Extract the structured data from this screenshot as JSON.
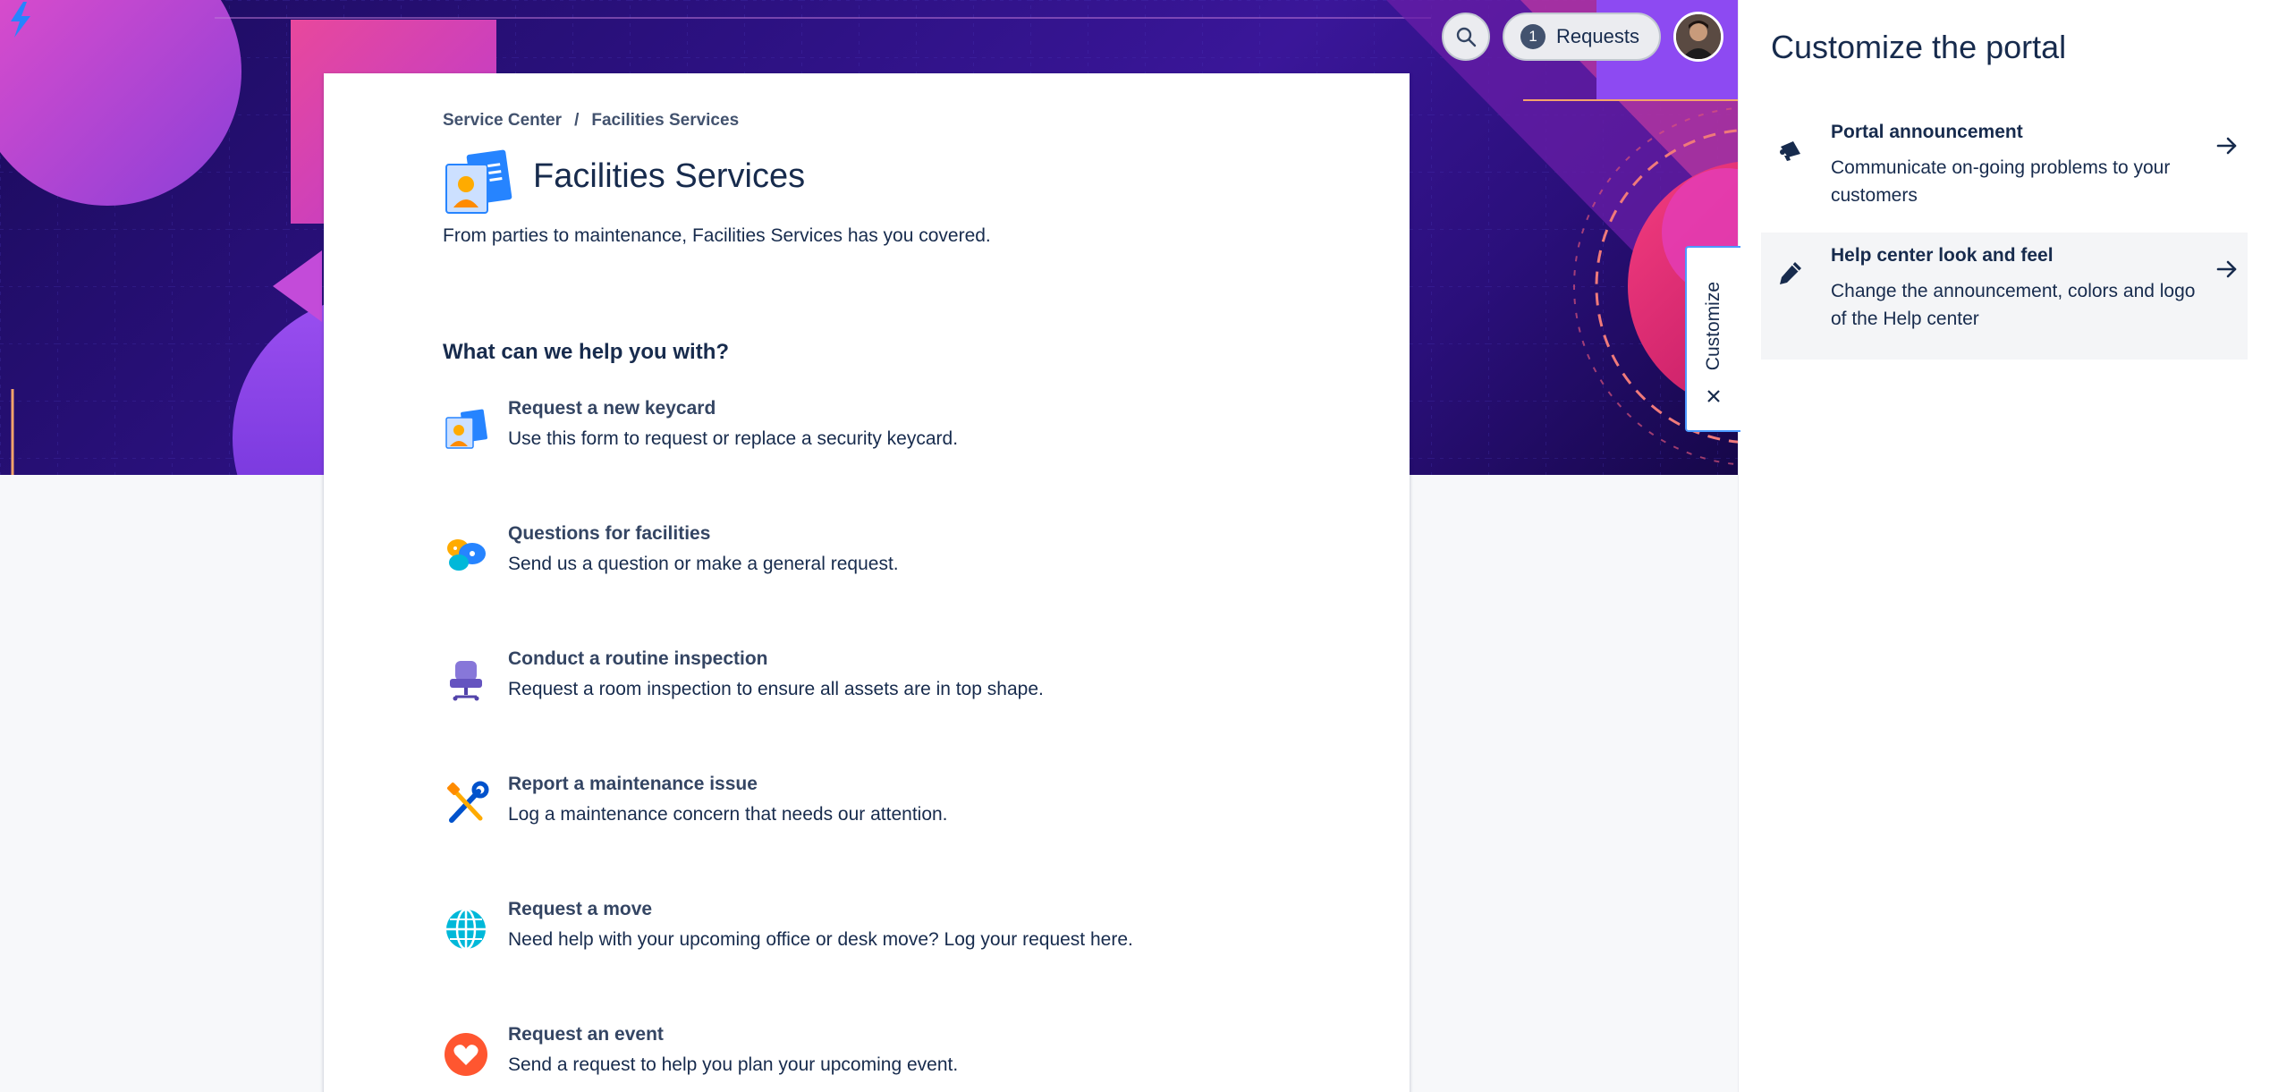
{
  "header": {
    "requests_count": "1",
    "requests_label": "Requests"
  },
  "breadcrumb": {
    "root": "Service Center",
    "separator": "/",
    "current": "Facilities Services"
  },
  "portal": {
    "title": "Facilities Services",
    "description": "From parties to maintenance, Facilities Services has you covered."
  },
  "help_heading": "What can we help you with?",
  "request_types": [
    {
      "icon": "keycard-icon",
      "title": "Request a new keycard",
      "description": "Use this form to request or replace a security keycard."
    },
    {
      "icon": "chat-bubbles-icon",
      "title": "Questions for facilities",
      "description": "Send us a question or make a general request."
    },
    {
      "icon": "chair-icon",
      "title": "Conduct a routine inspection",
      "description": "Request a room inspection to ensure all assets are in top shape."
    },
    {
      "icon": "tools-icon",
      "title": "Report a maintenance issue",
      "description": "Log a maintenance concern that needs our attention."
    },
    {
      "icon": "globe-icon",
      "title": "Request a move",
      "description": "Need help with your upcoming office or desk move? Log your request here."
    },
    {
      "icon": "heart-icon",
      "title": "Request an event",
      "description": "Send a request to help you plan your upcoming event."
    }
  ],
  "customize_tab": {
    "label": "Customize"
  },
  "panel": {
    "title": "Customize the portal",
    "items": [
      {
        "icon": "megaphone-icon",
        "title": "Portal announcement",
        "description": "Communicate on-going problems to your customers"
      },
      {
        "icon": "pencil-icon",
        "title": "Help center look and feel",
        "description": "Change the announcement, colors and logo of the Help center"
      }
    ]
  },
  "colors": {
    "hero_dark": "#1b0b5c",
    "hero_mid": "#3a1699",
    "accent_blue": "#4c9aff",
    "text_primary": "#172b4d",
    "page_bg": "#f7f8fa"
  }
}
